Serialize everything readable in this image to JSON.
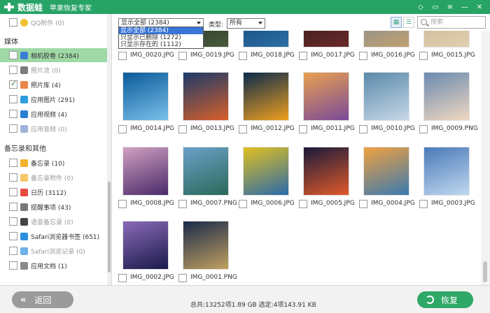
{
  "title": {
    "app_name": "数据蛙",
    "subtitle": "苹果恢复专家"
  },
  "sidebar": {
    "top_item": {
      "label": "QQ附件 (0)"
    },
    "media_header": "媒体",
    "media_items": [
      {
        "label": "相机胶卷 (2384)",
        "checked": false,
        "selected": true,
        "dim": false,
        "icon_color": "#3b7fd2",
        "icon": "camera-roll-icon"
      },
      {
        "label": "照片流 (0)",
        "checked": false,
        "selected": false,
        "dim": true,
        "icon_color": "#7c7c7c",
        "icon": "photo-stream-icon"
      },
      {
        "label": "照片库 (4)",
        "checked": true,
        "selected": false,
        "dim": false,
        "icon_color": "#e8864a",
        "icon": "photo-library-icon"
      },
      {
        "label": "应用图片 (291)",
        "checked": false,
        "selected": false,
        "dim": false,
        "icon_color": "#2f9de0",
        "icon": "app-photos-icon"
      },
      {
        "label": "应用视频 (4)",
        "checked": false,
        "selected": false,
        "dim": false,
        "icon_color": "#2a7fd0",
        "icon": "app-video-icon"
      },
      {
        "label": "应用音频 (0)",
        "checked": false,
        "selected": false,
        "dim": true,
        "icon_color": "#9fb3d6",
        "icon": "app-audio-icon"
      }
    ],
    "memo_header": "备忘录和其他",
    "memo_items": [
      {
        "label": "备忘录 (10)",
        "checked": false,
        "dim": false,
        "icon_color": "#f2b32c",
        "icon": "notes-icon"
      },
      {
        "label": "备忘录附件 (0)",
        "checked": false,
        "dim": true,
        "icon_color": "#f6c766",
        "icon": "notes-attachment-icon"
      },
      {
        "label": "日历 (3112)",
        "checked": false,
        "dim": false,
        "icon_color": "#e84a3f",
        "icon": "calendar-icon"
      },
      {
        "label": "提醒事项 (43)",
        "checked": false,
        "dim": false,
        "icon_color": "#7a7a7a",
        "icon": "reminders-icon"
      },
      {
        "label": "语音备忘录 (0)",
        "checked": false,
        "dim": true,
        "icon_color": "#444444",
        "icon": "voice-memo-icon"
      },
      {
        "label": "Safari浏览器书签 (651)",
        "checked": false,
        "dim": false,
        "icon_color": "#2d8de0",
        "icon": "safari-bookmark-icon"
      },
      {
        "label": "Safari浏览记录 (0)",
        "checked": false,
        "dim": true,
        "icon_color": "#6fb0ea",
        "icon": "safari-history-icon"
      },
      {
        "label": "应用文档 (1)",
        "checked": false,
        "dim": false,
        "icon_color": "#8a8a8a",
        "icon": "app-docs-icon"
      }
    ]
  },
  "toolbar": {
    "filter_value": "显示全部 (2384)",
    "filter_options": [
      "显示全部 (2384)",
      "只显示已删除 (1272)",
      "只显示存在的 (1112)"
    ],
    "type_label": "类型:",
    "type_value": "所有",
    "search_placeholder": "搜索"
  },
  "files": [
    "IMG_0020.JPG",
    "IMG_0019.JPG",
    "IMG_0018.JPG",
    "IMG_0017.JPG",
    "IMG_0016.JPG",
    "IMG_0015.JPG",
    "IMG_0014.JPG",
    "IMG_0013.JPG",
    "IMG_0012.JPG",
    "IMG_0011.JPG",
    "IMG_0010.JPG",
    "IMG_0009.PNG",
    "IMG_0008.JPG",
    "IMG_0007.PNG",
    "IMG_0006.JPG",
    "IMG_0005.JPG",
    "IMG_0004.JPG",
    "IMG_0003.JPG",
    "IMG_0002.JPG",
    "IMG_0001.PNG"
  ],
  "thumb_colors": [
    [
      "#3a2a1a",
      "#6b4b2a"
    ],
    [
      "#1a2a2a",
      "#4a5a3a"
    ],
    [
      "#0f3f6f",
      "#2b6fa5"
    ],
    [
      "#2a1a1a",
      "#6a2a2a"
    ],
    [
      "#7a8a9a",
      "#c0a070"
    ],
    [
      "#c8b090",
      "#e0d0b0"
    ],
    [
      "#0b5a9a",
      "#7ac0ea"
    ],
    [
      "#1a3a6a",
      "#d8602a"
    ],
    [
      "#0a2a4a",
      "#f0a020"
    ],
    [
      "#e8a050",
      "#7a4a9a"
    ],
    [
      "#5a8aaa",
      "#c8d8e8"
    ],
    [
      "#6a8ab0",
      "#f0d8c0"
    ],
    [
      "#d0a0c0",
      "#4a2a6a"
    ],
    [
      "#6aa0c8",
      "#2a6a5a"
    ],
    [
      "#e0c020",
      "#2a6aa8"
    ],
    [
      "#1a1a3a",
      "#e05a2a"
    ],
    [
      "#f0a040",
      "#3a7ab0"
    ],
    [
      "#4a7ab8",
      "#c0d8f0"
    ],
    [
      "#8a6ab8",
      "#1a1a4a"
    ],
    [
      "#1a2a4a",
      "#c0a060"
    ]
  ],
  "bottom": {
    "back_label": "返回",
    "stats": "总共:13252项1.89 GB 选定:4项143.91 KB",
    "recover_label": "恢复"
  }
}
